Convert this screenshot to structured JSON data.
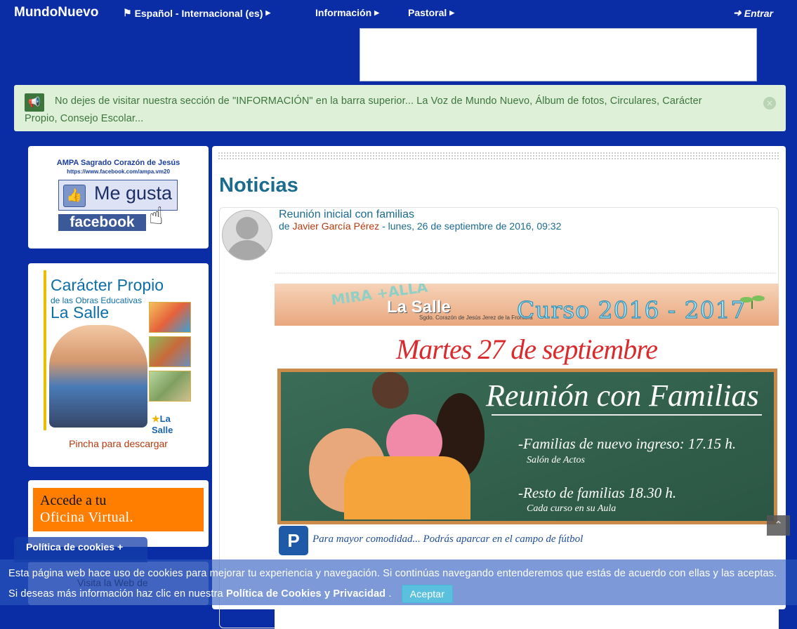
{
  "navbar": {
    "brand": "MundoNuevo",
    "language": "Español - Internacional (es)",
    "menu_informacion": "Información",
    "menu_pastoral": "Pastoral",
    "login": "Entrar"
  },
  "alert": {
    "text": "No dejes de visitar nuestra sección de \"INFORMACIÓN\" en la barra superior... La Voz de Mundo Nuevo, Álbum de fotos, Circulares, Carácter Propio, Consejo Escolar...",
    "close": "×"
  },
  "sidebar": {
    "facebook": {
      "title": "AMPA Sagrado Corazón de Jesús",
      "url": "https://www.facebook.com/ampa.vm20",
      "like_label": "Me gusta",
      "brand": "facebook"
    },
    "caracter_propio": {
      "line1": "Carácter Propio",
      "line2": "de las Obras Educativas",
      "line3": "La Salle",
      "logo": "La Salle",
      "link": "Pincha para descargar"
    },
    "oficina": {
      "line1": "Accede a tu",
      "line2": "Oficina Virtual."
    },
    "visita": "Visita la Web de"
  },
  "main": {
    "title": "Noticias",
    "post": {
      "subject": "Reunión inicial con familias",
      "by_prefix": "de",
      "author": "Javier García Pérez",
      "date": "- lunes, 26 de septiembre de 2016, 09:32",
      "poster": {
        "mira": "MIRA +ALLÁ",
        "brand": "La Salle",
        "brand_sub": "Sgdo. Corazón de Jesús  Jerez de la Frontera",
        "curso": "Curso 2016 - 2017",
        "date": "Martes 27 de septiembre",
        "board_title": "Reunión con Familias",
        "line1": "-Familias de nuevo ingreso: 17.15 h.",
        "line1_sub": "Salón de Actos",
        "line2": "-Resto de familias 18.30 h.",
        "line2_sub": "Cada curso en su Aula",
        "parking_icon": "P",
        "parking": "Para mayor comodidad... Podrás aparcar en el campo de fútbol"
      }
    }
  },
  "cookies": {
    "tab": "Política de cookies +",
    "text_part1": "Esta página web hace uso de cookies para mejorar tu experiencia y navegación. Si continúas navegando entenderemos que estás de acuerdo con ellas y las aceptas. Si deseas más información haz clic en nuestra",
    "link": "Política de Cookies y Privacidad",
    "text_part2": ".",
    "accept": "Aceptar"
  },
  "colors": {
    "page_bg": "#0a2ca4",
    "alert_bg": "#dff0d8",
    "alert_text": "#3c763d",
    "title": "#1b6b8e",
    "author_link": "#b53a0d",
    "accept_btn": "#5bc0de"
  }
}
